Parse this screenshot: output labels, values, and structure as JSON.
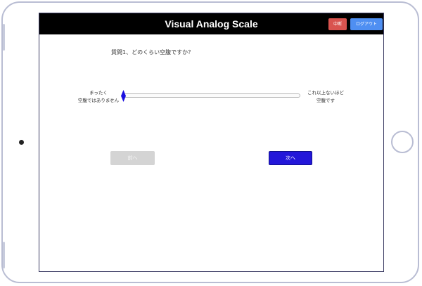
{
  "header": {
    "title": "Visual Analog Scale",
    "suspend_label": "中断",
    "logout_label": "ログアウト",
    "suspend_color": "#d9534f",
    "logout_color": "#4f8ff2"
  },
  "question": {
    "text": "質問1、どのくらい空腹ですか？"
  },
  "scale": {
    "left_label_line1": "まったく",
    "left_label_line2": "空腹ではありません",
    "right_label_line1": "これ以上ないほど",
    "right_label_line2": "空腹です",
    "value_fraction": 0,
    "thumb_color": "#1b10e0"
  },
  "navigation": {
    "prev_label": "前へ",
    "next_label": "次へ",
    "next_color": "#2317d9"
  },
  "device": {
    "home_button_icon": "home-button-icon",
    "camera_icon": "camera-icon"
  }
}
